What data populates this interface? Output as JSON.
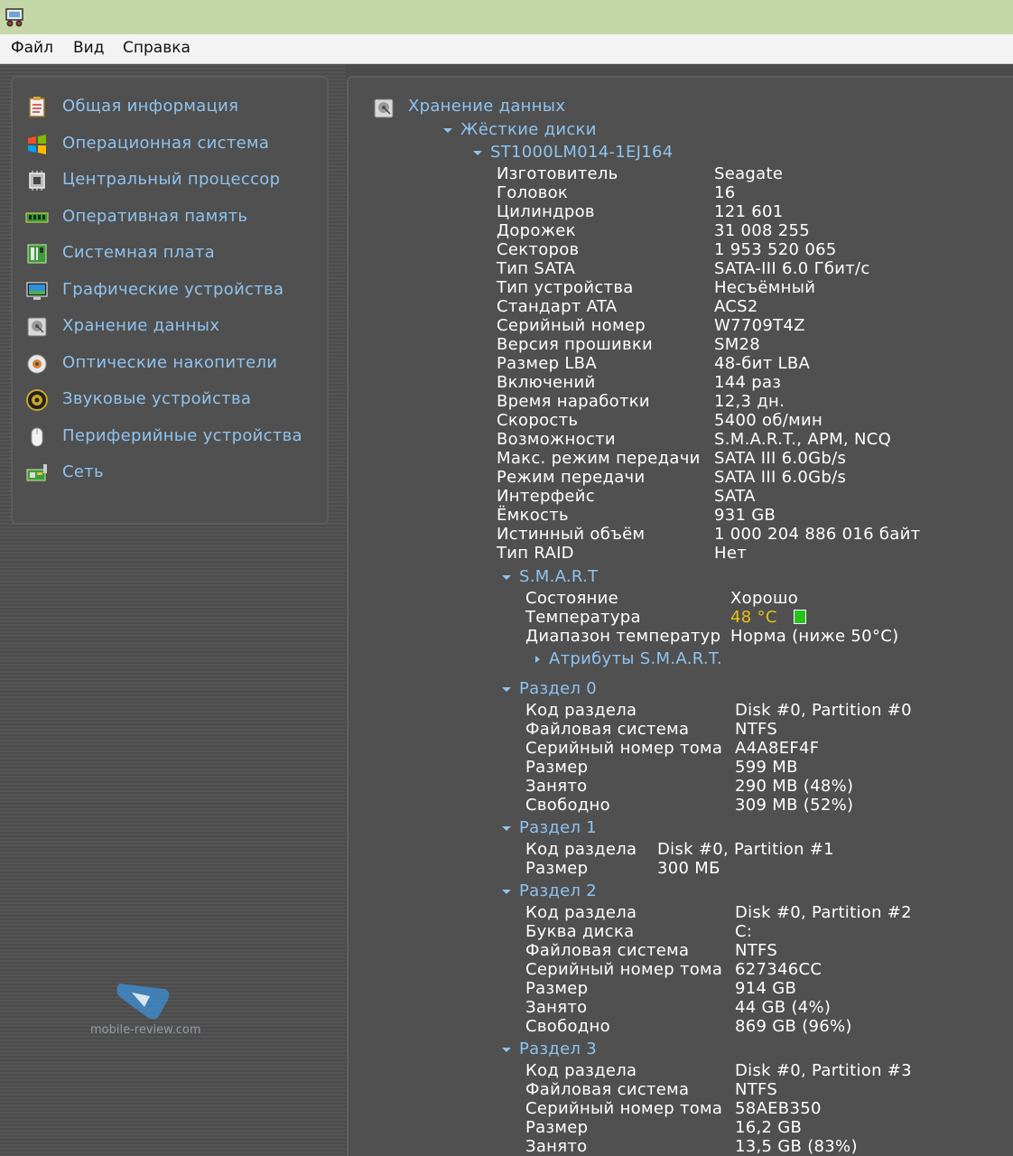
{
  "menu": [
    "Файл",
    "Вид",
    "Справка"
  ],
  "sidebar": [
    {
      "label": "Общая информация",
      "icon": "summary-icon"
    },
    {
      "label": "Операционная система",
      "icon": "windows-icon"
    },
    {
      "label": "Центральный процессор",
      "icon": "cpu-icon"
    },
    {
      "label": "Оперативная память",
      "icon": "ram-icon"
    },
    {
      "label": "Системная плата",
      "icon": "motherboard-icon"
    },
    {
      "label": "Графические устройства",
      "icon": "monitor-icon"
    },
    {
      "label": "Хранение данных",
      "icon": "hdd-icon"
    },
    {
      "label": "Оптические накопители",
      "icon": "optical-disc-icon"
    },
    {
      "label": "Звуковые устройства",
      "icon": "speaker-icon"
    },
    {
      "label": "Периферийные устройства",
      "icon": "mouse-icon"
    },
    {
      "label": "Сеть",
      "icon": "network-icon"
    }
  ],
  "tree": {
    "root": "Хранение данных",
    "group": "Жёсткие диски",
    "disk": "ST1000LM014-1EJ164",
    "disk_props": [
      [
        "Изготовитель",
        "Seagate"
      ],
      [
        "Головок",
        "16"
      ],
      [
        "Цилиндров",
        "121 601"
      ],
      [
        "Дорожек",
        "31 008 255"
      ],
      [
        "Секторов",
        "1 953 520 065"
      ],
      [
        "Тип SATA",
        "SATA-III 6.0 Гбит/с"
      ],
      [
        "Тип устройства",
        "Несъёмный"
      ],
      [
        "Стандарт ATA",
        "ACS2"
      ],
      [
        "Серийный номер",
        "W7709T4Z"
      ],
      [
        "Версия прошивки",
        "SM28"
      ],
      [
        "Размер LBA",
        "48-бит LBA"
      ],
      [
        "Включений",
        "144 раз"
      ],
      [
        "Время наработки",
        "12,3 дн."
      ],
      [
        "Скорость",
        "5400 об/мин"
      ],
      [
        "Возможности",
        "S.M.A.R.T., APM, NCQ"
      ],
      [
        "Макс. режим передачи",
        "SATA III 6.0Gb/s"
      ],
      [
        "Режим передачи",
        "SATA III 6.0Gb/s"
      ],
      [
        "Интерфейс",
        "SATA"
      ],
      [
        "Ёмкость",
        "931 GB"
      ],
      [
        "Истинный объём",
        "1 000 204 886 016 байт"
      ],
      [
        "Тип RAID",
        "Нет"
      ]
    ],
    "smart": {
      "title": "S.M.A.R.T",
      "props": [
        [
          "Состояние",
          "Хорошо"
        ],
        [
          "Температура",
          "48 °C"
        ],
        [
          "Диапазон температур",
          "Норма (ниже 50°C)"
        ]
      ],
      "attributes_label": "Атрибуты S.M.A.R.T."
    },
    "partitions": [
      {
        "title": "Раздел 0",
        "props": [
          [
            "Код раздела",
            "Disk #0, Partition #0"
          ],
          [
            "Файловая система",
            "NTFS"
          ],
          [
            "Серийный номер тома",
            "A4A8EF4F"
          ],
          [
            "Размер",
            "599 MB"
          ],
          [
            "Занято",
            "290 MB (48%)"
          ],
          [
            "Свободно",
            "309 MB (52%)"
          ]
        ]
      },
      {
        "title": "Раздел 1",
        "props": [
          [
            "Код раздела",
            "Disk #0, Partition #1"
          ],
          [
            "Размер",
            "300 МБ"
          ]
        ]
      },
      {
        "title": "Раздел 2",
        "props": [
          [
            "Код раздела",
            "Disk #0, Partition #2"
          ],
          [
            "Буква диска",
            "C:"
          ],
          [
            "Файловая система",
            "NTFS"
          ],
          [
            "Серийный номер тома",
            "627346CC"
          ],
          [
            "Размер",
            "914 GB"
          ],
          [
            "Занято",
            "44 GB (4%)"
          ],
          [
            "Свободно",
            "869 GB (96%)"
          ]
        ]
      },
      {
        "title": "Раздел 3",
        "props": [
          [
            "Код раздела",
            "Disk #0, Partition #3"
          ],
          [
            "Файловая система",
            "NTFS"
          ],
          [
            "Серийный номер тома",
            "58AEB350"
          ],
          [
            "Размер",
            "16,2 GB"
          ],
          [
            "Занято",
            "13,5 GB (83%)"
          ]
        ]
      }
    ]
  },
  "watermark": "mobile-review.com",
  "colors": {
    "link": "#8fc3ee",
    "text": "#ffffff",
    "warm": "#e8c11a",
    "ok": "#27c21c",
    "titlebar": "#c5d7a6"
  }
}
